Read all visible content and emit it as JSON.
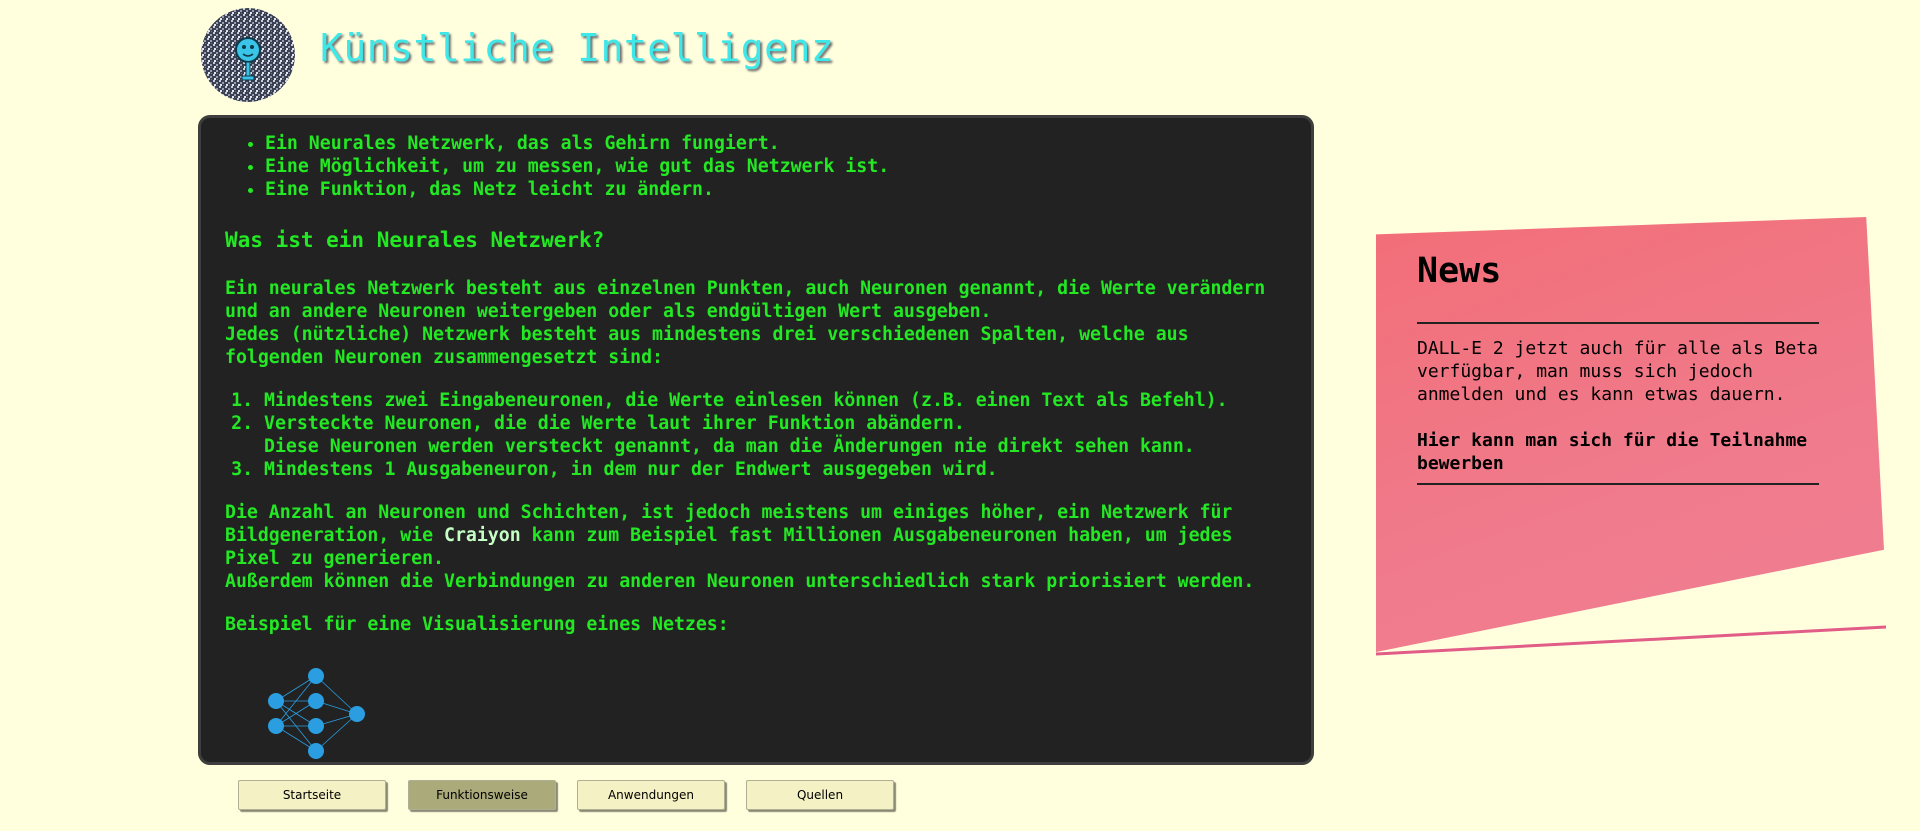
{
  "header": {
    "title": "Künstliche Intelligenz",
    "logo_icon": "robot-head-icon"
  },
  "content": {
    "requirements": [
      "Ein Neurales Netzwerk, das als Gehirn fungiert.",
      "Eine Möglichkeit, um zu messen, wie gut das Netzwerk ist.",
      "Eine Funktion, das Netz leicht zu ändern."
    ],
    "heading": "Was ist ein Neurales Netzwerk?",
    "intro_line1": "Ein neurales Netzwerk besteht aus einzelnen Punkten, auch Neuronen genannt, die Werte verändern und an andere Neuronen weitergeben oder als endgültigen Wert ausgeben.",
    "intro_line2": "Jedes (nützliche) Netzwerk besteht aus mindestens drei verschiedenen Spalten, welche aus folgenden Neuronen zusammengesetzt sind:",
    "layers": [
      "Mindestens zwei Eingabeneuronen, die Werte einlesen können (z.B. einen Text als Befehl).",
      "Versteckte Neuronen, die die Werte laut ihrer Funktion abändern.",
      "Mindestens 1 Ausgabeneuron, in dem nur der Endwert ausgegeben wird."
    ],
    "layers_note": "Diese Neuronen werden versteckt genannt, da man die Änderungen nie direkt sehen kann.",
    "para2_before": "Die Anzahl an Neuronen und Schichten, ist jedoch meistens um einiges höher, ein Netzwerk für Bildgeneration, wie ",
    "para2_brand": "Craiyon",
    "para2_after": " kann zum Beispiel fast Millionen Ausgabeneuronen haben, um jedes Pixel zu generieren.",
    "para2_line2": "Außerdem können die Verbindungen zu anderen Neuronen unterschiedlich stark priorisiert werden.",
    "example_label": "Beispiel für eine Visualisierung eines Netzes:",
    "diagram_icon": "neural-network-icon"
  },
  "nav": {
    "items": [
      "Startseite",
      "Funktionsweise",
      "Anwendungen",
      "Quellen"
    ],
    "active": "Funktionsweise"
  },
  "news": {
    "title": "News",
    "text": "DALL-E 2 jetzt auch für alle als Beta verfügbar, man muss sich jedoch anmelden und es kann etwas dauern.",
    "link": "Hier kann man sich für die Teilnahme bewerben"
  },
  "colors": {
    "page_bg": "#ffffde",
    "terminal_bg": "#222222",
    "terminal_text": "#23e823",
    "title": "#3fe8e8",
    "note": "#f07b8c",
    "nav_active": "#abaa7a",
    "nav_bg": "#f4f1c4",
    "network_nodes": "#2a9ee0"
  }
}
